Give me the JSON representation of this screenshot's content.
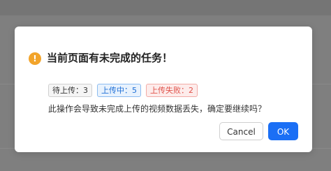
{
  "dialog": {
    "title": "当前页面有未完成的任务！",
    "icon": "warning-icon",
    "icon_glyph": "!",
    "accent_color": "#f2a42b",
    "tags": {
      "pending": "待上传：3",
      "uploading": "上传中：5",
      "failed": "上传失败：2"
    },
    "message": "此操作会导致未完成上传的视频数据丢失，确定要继续吗？",
    "cancel_label": "Cancel",
    "ok_label": "OK",
    "primary_color": "#1b6ff5"
  }
}
